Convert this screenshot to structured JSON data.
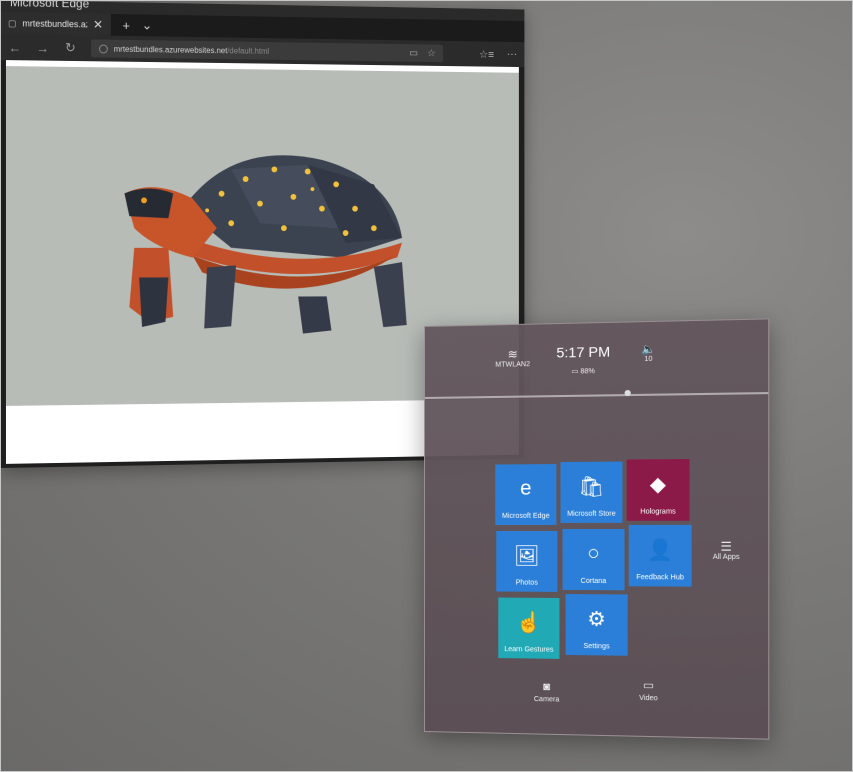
{
  "edge": {
    "window_title": "Microsoft Edge",
    "tab_title": "mrtestbundles.azurewet",
    "tab_close": "✕",
    "new_tab": "+",
    "tab_list": "⌄",
    "url_host": "mrtestbundles.azurewebsites.net",
    "url_path": "/default.html",
    "nav": {
      "back": "←",
      "forward": "→",
      "refresh": "↻"
    },
    "address_icons": {
      "reading_view": "▭",
      "favorite": "☆"
    },
    "toolbar": {
      "favorites_hub": "☆≡",
      "more": "···"
    }
  },
  "start_menu": {
    "status": {
      "wifi_icon": "wifi-icon",
      "wifi_name": "MTWLAN2",
      "time": "5:17 PM",
      "battery": "88%",
      "volume_icon": "speaker-icon",
      "volume": "10"
    },
    "tiles": [
      {
        "label": "Microsoft Edge",
        "icon": "edge-icon",
        "glyph": "e",
        "color": "#2b7fd8"
      },
      {
        "label": "Microsoft Store",
        "icon": "store-icon",
        "glyph": "🛍",
        "color": "#2b7fd8"
      },
      {
        "label": "Holograms",
        "icon": "holograms-icon",
        "glyph": "◆",
        "color": "#8c1a48"
      },
      {
        "label": "Photos",
        "icon": "photos-icon",
        "glyph": "🖼",
        "color": "#2b7fd8"
      },
      {
        "label": "Cortana",
        "icon": "cortana-icon",
        "glyph": "○",
        "color": "#2b7fd8"
      },
      {
        "label": "Feedback Hub",
        "icon": "feedback-icon",
        "glyph": "👤",
        "color": "#2b7fd8"
      },
      {
        "label": "Learn Gestures",
        "icon": "gesture-icon",
        "glyph": "☝",
        "color": "#22a9b6"
      },
      {
        "label": "Settings",
        "icon": "gear-icon",
        "glyph": "⚙",
        "color": "#2b7fd8"
      }
    ],
    "all_apps": {
      "label": "All Apps",
      "glyph": "☰"
    },
    "camera": {
      "label": "Camera",
      "glyph": "◙"
    },
    "video": {
      "label": "Video",
      "glyph": "▭"
    }
  }
}
